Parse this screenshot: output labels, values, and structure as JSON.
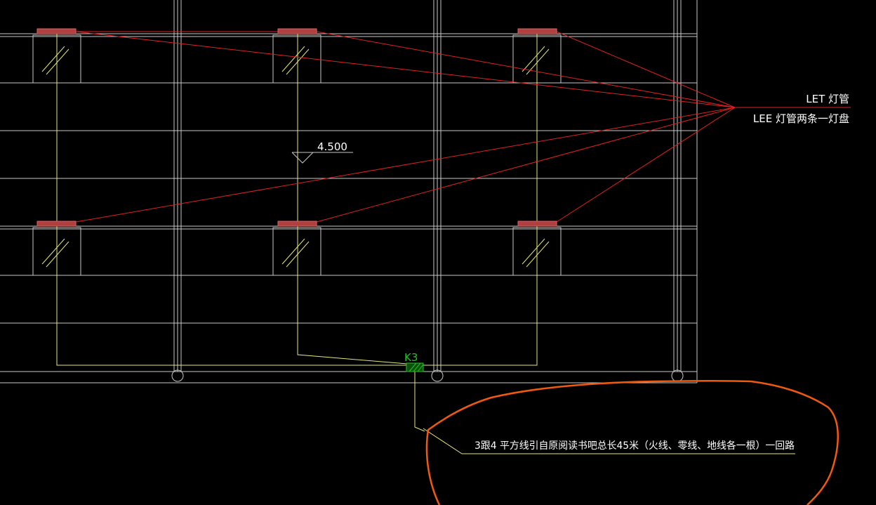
{
  "labels": {
    "legend_line1": "LET 灯管",
    "legend_line2": "LEE 灯管两条一灯盘",
    "elevation": "4.500",
    "switch_tag": "K3",
    "note": "3跟4 平方线引自原阅读书吧总长45米（火线、零线、地线各一根）一回路"
  },
  "colors": {
    "background": "#000000",
    "grid": "#c8c8c8",
    "wire": "#e6e67a",
    "leader": "#e02020",
    "fixture_fill": "#b04040",
    "switch": "#21c421",
    "highlight": "#f05a0f",
    "text": "#ffffff"
  }
}
